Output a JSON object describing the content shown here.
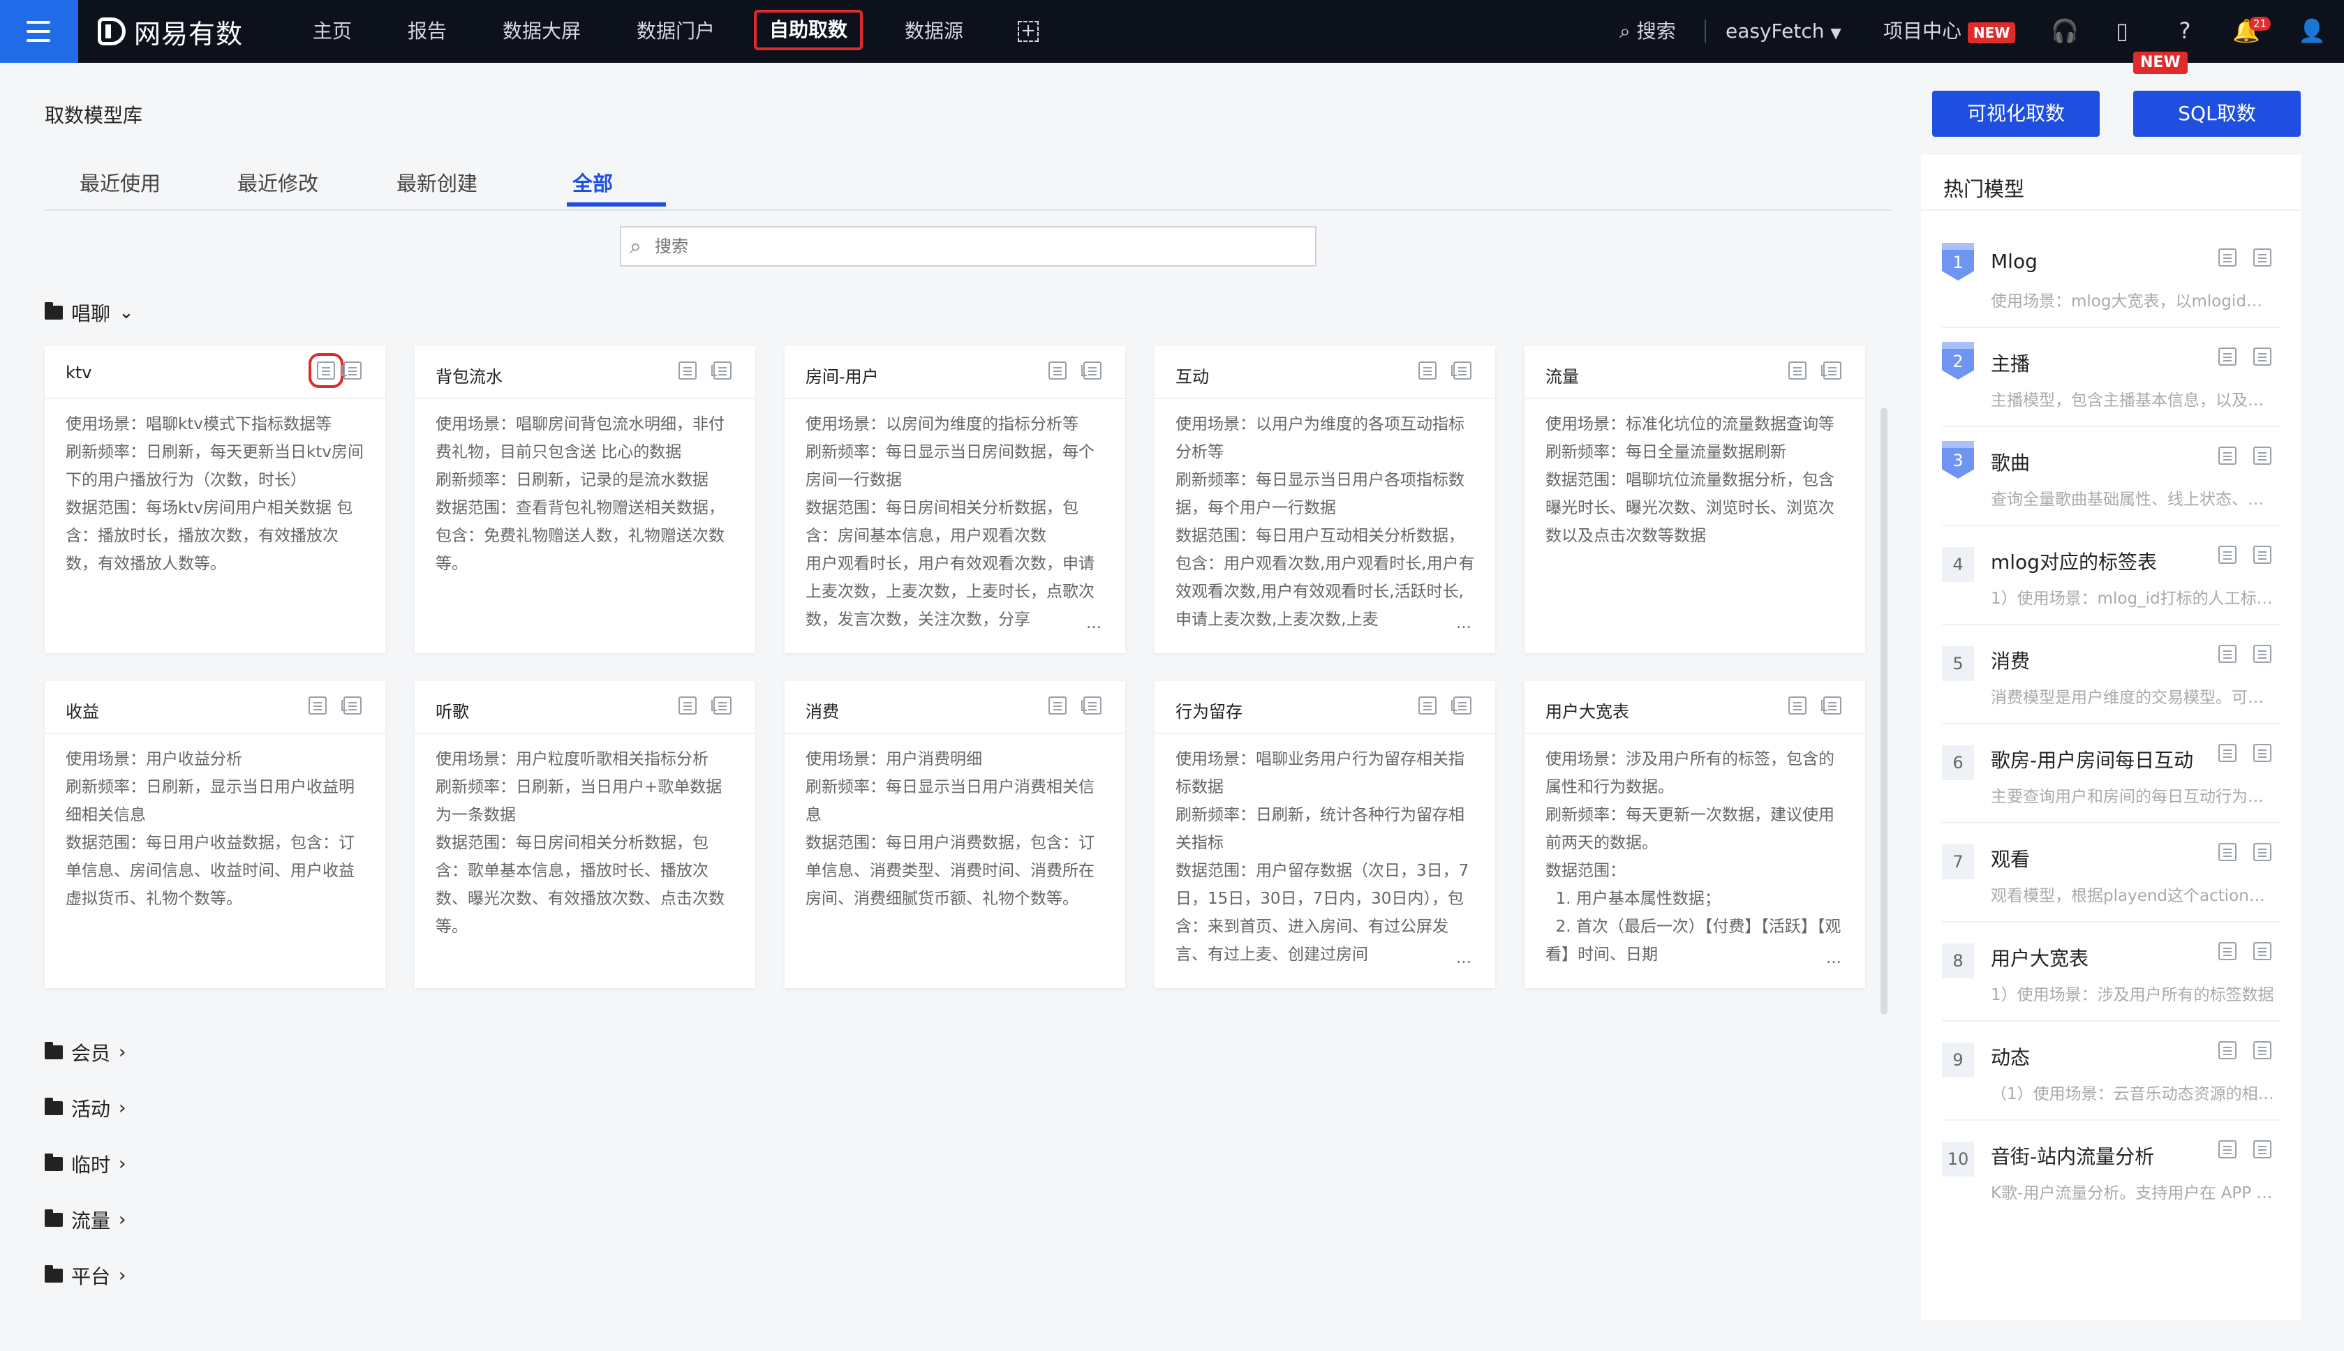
{
  "nav": {
    "logo": "网易有数",
    "items": [
      "主页",
      "报告",
      "数据大屏",
      "数据门户",
      "自助取数",
      "数据源"
    ],
    "search": "搜索",
    "user": "easyFetch",
    "project_center": "项目中心",
    "new_badge": "NEW",
    "bell_count": "21"
  },
  "page": {
    "title": "取数模型库",
    "btn_visual": "可视化取数",
    "btn_sql": "SQL取数",
    "btn_sql_badge": "NEW",
    "tabs": [
      "最近使用",
      "最近修改",
      "最新创建",
      "全部"
    ],
    "search_placeholder": "搜索"
  },
  "groups": {
    "changliao": "唱聊",
    "collapsed": [
      "会员",
      "活动",
      "临时",
      "流量",
      "平台"
    ]
  },
  "cards": [
    {
      "title": "ktv",
      "body": "使用场景：唱聊ktv模式下指标数据等\n刷新频率：日刷新，每天更新当日ktv房间下的用户播放行为（次数，时长）\n数据范围：每场ktv房间用户相关数据 包含：播放时长，播放次数，有效播放次数，有效播放人数等。"
    },
    {
      "title": "背包流水",
      "body": "使用场景：唱聊房间背包流水明细，非付费礼物，目前只包含送 比心的数据\n刷新频率：日刷新，记录的是流水数据\n数据范围：查看背包礼物赠送相关数据，包含：免费礼物赠送人数，礼物赠送次数等。"
    },
    {
      "title": "房间-用户",
      "body": "使用场景：以房间为维度的指标分析等\n刷新频率：每日显示当日房间数据，每个房间一行数据\n数据范围：每日房间相关分析数据，包含：房间基本信息，用户观看次数\n用户观看时长，用户有效观看次数，申请上麦次数，上麦次数，上麦时长，点歌次数，发言次数，关注次数，分享"
    },
    {
      "title": "互动",
      "body": "使用场景：以用户为维度的各项互动指标分析等\n刷新频率：每日显示当日用户各项指标数据，每个用户一行数据\n数据范围：每日用户互动相关分析数据，包含：用户观看次数,用户观看时长,用户有效观看次数,用户有效观看时长,活跃时长,申请上麦次数,上麦次数,上麦"
    },
    {
      "title": "流量",
      "body": "使用场景：标准化坑位的流量数据查询等\n刷新频率：每日全量流量数据刷新\n数据范围：唱聊坑位流量数据分析，包含曝光时长、曝光次数、浏览时长、浏览次数以及点击次数等数据"
    },
    {
      "title": "收益",
      "body": "使用场景：用户收益分析\n刷新频率：日刷新，显示当日用户收益明细相关信息\n数据范围：每日用户收益数据，包含：订单信息、房间信息、收益时间、用户收益虚拟货币、礼物个数等。"
    },
    {
      "title": "听歌",
      "body": "使用场景：用户粒度听歌相关指标分析\n刷新频率：日刷新，当日用户+歌单数据为一条数据\n数据范围：每日房间相关分析数据，包含：歌单基本信息，播放时长、播放次数、曝光次数、有效播放次数、点击次数等。"
    },
    {
      "title": "消费",
      "body": "使用场景：用户消费明细\n刷新频率：每日显示当日用户消费相关信息\n数据范围：每日用户消费数据，包含：订单信息、消费类型、消费时间、消费所在房间、消费细腻货币额、礼物个数等。"
    },
    {
      "title": "行为留存",
      "body": "使用场景：唱聊业务用户行为留存相关指标数据\n刷新频率：日刷新，统计各种行为留存相关指标\n数据范围：用户留存数据（次日，3日，7日，15日，30日，7日内，30日内），包含：来到首页、进入房间、有过公屏发言、有过上麦、创建过房间"
    },
    {
      "title": "用户大宽表",
      "body": "使用场景：涉及用户所有的标签，包含的属性和行为数据。\n刷新频率：每天更新一次数据，建议使用前两天的数据。\n数据范围：\n  1. 用户基本属性数据；\n  2. 首次（最后一次）【付费】【活跃】【观看】时间、日期"
    }
  ],
  "hot": {
    "title": "热门模型",
    "items": [
      {
        "rank": "1",
        "name": "Mlog",
        "desc": "使用场景：mlog大宽表，以mlogid为维度的数据"
      },
      {
        "rank": "2",
        "name": "主播",
        "desc": "主播模型，包含主播基本信息，以及主播相关数据"
      },
      {
        "rank": "3",
        "name": "歌曲",
        "desc": "查询全量歌曲基础属性、线上状态、歌曲数据"
      },
      {
        "rank": "4",
        "name": "mlog对应的标签表",
        "desc": "1）使用场景：mlog_id打标的人工标签数据"
      },
      {
        "rank": "5",
        "name": "消费",
        "desc": "消费模型是用户维度的交易模型。可用于分析"
      },
      {
        "rank": "6",
        "name": "歌房-用户房间每日互动",
        "desc": "主要查询用户和房间的每日互动行为数据"
      },
      {
        "rank": "7",
        "name": "观看",
        "desc": "观看模型，根据playend这个action计算"
      },
      {
        "rank": "8",
        "name": "用户大宽表",
        "desc": "1）使用场景：涉及用户所有的标签数据"
      },
      {
        "rank": "9",
        "name": "动态",
        "desc": "（1）使用场景：云音乐动态资源的相关数据"
      },
      {
        "rank": "10",
        "name": "音街-站内流量分析",
        "desc": "K歌-用户流量分析。支持用户在 APP 内的行为"
      }
    ]
  }
}
